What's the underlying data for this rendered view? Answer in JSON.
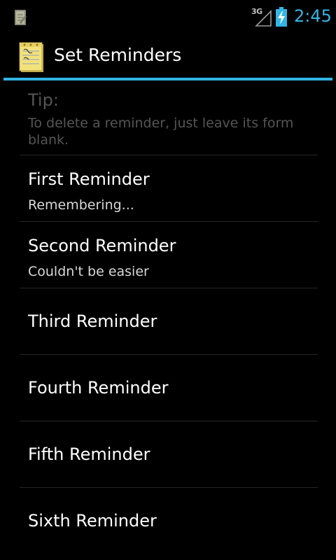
{
  "status_bar": {
    "network_type": "3G",
    "time": "2:45",
    "icons": [
      "notes-notification-icon",
      "signal-icon",
      "battery-charging-icon"
    ],
    "clock_color": "#33b5e5"
  },
  "action_bar": {
    "title": "Set Reminders",
    "icon": "notepad-icon",
    "accent_color": "#33b5e5"
  },
  "tip": {
    "title": "Tip:",
    "summary": "To delete a reminder, just leave its form blank."
  },
  "reminders": [
    {
      "title": "First Reminder",
      "summary": "Remembering..."
    },
    {
      "title": "Second Reminder",
      "summary": "Couldn't be easier"
    },
    {
      "title": "Third Reminder",
      "summary": ""
    },
    {
      "title": "Fourth Reminder",
      "summary": ""
    },
    {
      "title": "Fifth Reminder",
      "summary": ""
    },
    {
      "title": "Sixth Reminder",
      "summary": ""
    }
  ]
}
